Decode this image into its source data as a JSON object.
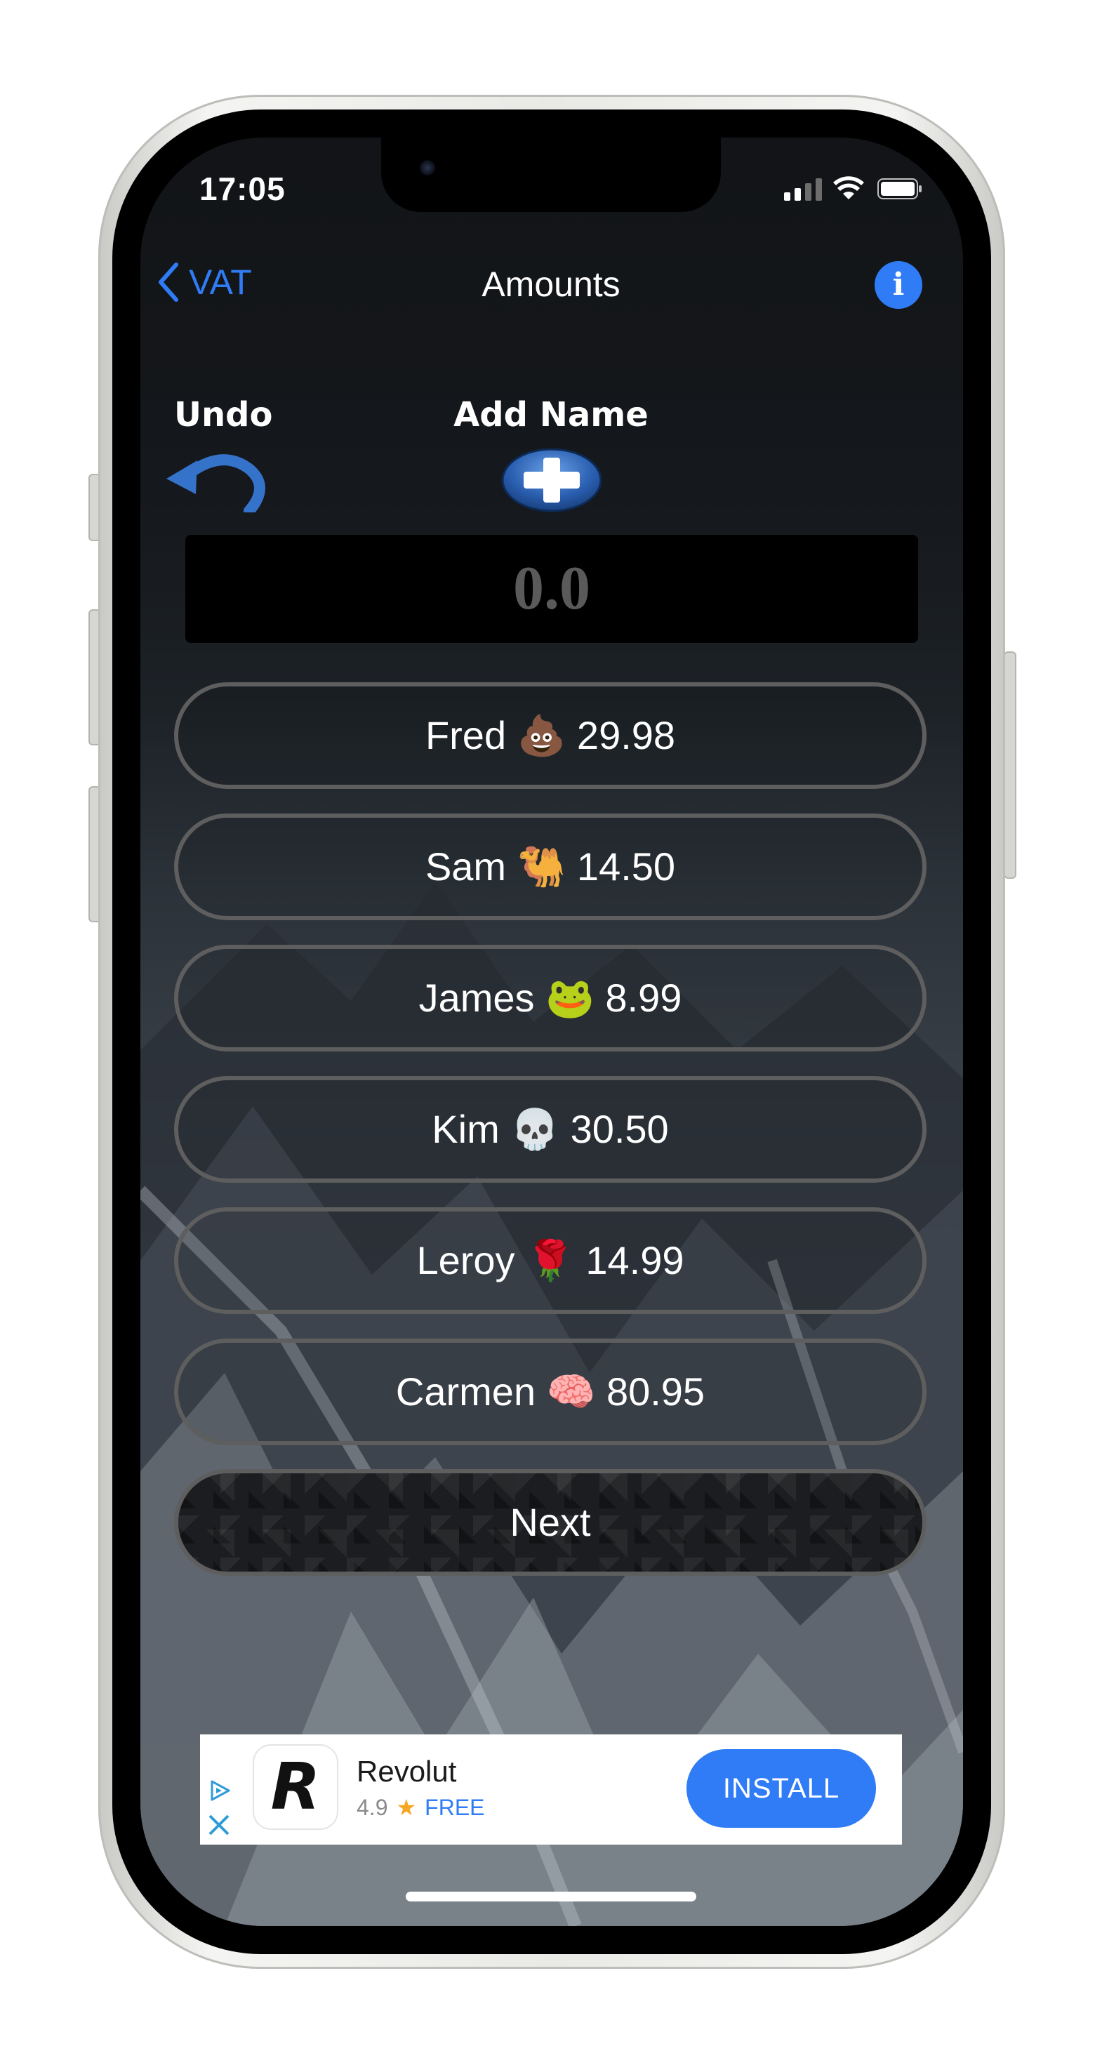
{
  "status_bar": {
    "time": "17:05"
  },
  "nav": {
    "back_label": "VAT",
    "title": "Amounts",
    "info_glyph": "i"
  },
  "controls": {
    "undo_label": "Undo",
    "add_name_label": "Add Name"
  },
  "amount_input": {
    "value": "0.0"
  },
  "entries": [
    {
      "label": "Fred 💩 29.98"
    },
    {
      "label": "Sam 🐫 14.50"
    },
    {
      "label": "James 🐸 8.99"
    },
    {
      "label": "Kim 💀 30.50"
    },
    {
      "label": "Leroy 🌹 14.99"
    },
    {
      "label": "Carmen 🧠 80.95"
    }
  ],
  "next_button": {
    "label": "Next"
  },
  "ad": {
    "logo_letter": "R",
    "app_name": "Revolut",
    "rating": "4.9",
    "price": "FREE",
    "install_label": "INSTALL"
  },
  "colors": {
    "accent": "#2f7cf6",
    "button_border": "#5e5e5e",
    "background": "#15181c"
  },
  "icons": [
    "chevron-left-icon",
    "info-icon",
    "undo-arrow-icon",
    "plus-icon",
    "adchoices-icon",
    "close-icon",
    "star-icon",
    "wifi-icon",
    "battery-icon",
    "cellular-signal-icon"
  ]
}
